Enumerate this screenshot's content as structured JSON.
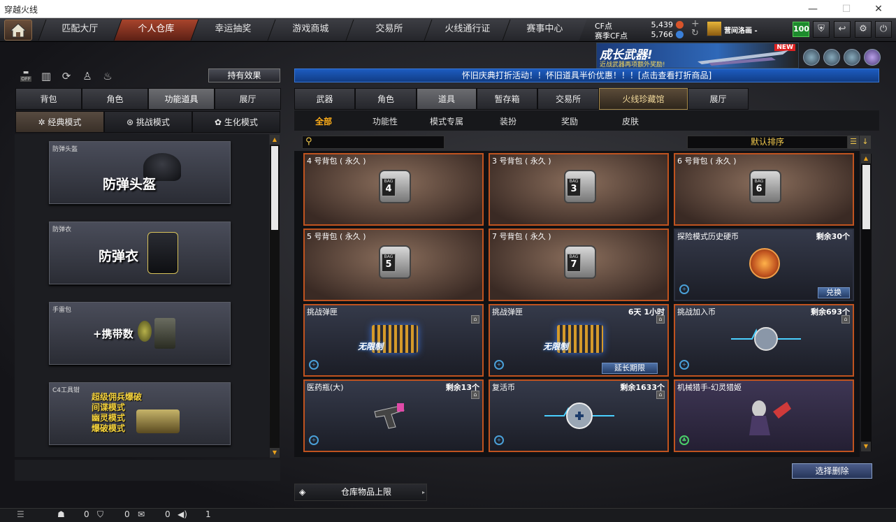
{
  "window": {
    "title": "穿越火线",
    "min": "—",
    "max": "☐",
    "close": "✕"
  },
  "nav": {
    "tabs": [
      "匹配大厅",
      "个人仓库",
      "幸运抽奖",
      "游戏商城",
      "交易所",
      "火线通行证",
      "赛事中心"
    ],
    "active_index": 1
  },
  "currency": {
    "cf_label": "CF点",
    "cf_value": "5,439",
    "season_label": "赛季CF点",
    "season_value": "5,766",
    "plus": "+",
    "refresh": "↻"
  },
  "user": {
    "name": "营间洛画 -",
    "level": "100"
  },
  "banner": {
    "title": "成长武器!",
    "subtitle": "近战武器再项额外奖励!",
    "badge": "NEW"
  },
  "left": {
    "toggle_label": "OFF",
    "holding_button": "持有效果",
    "tabs": [
      "背包",
      "角色",
      "功能道具",
      "展厅"
    ],
    "active_tab": 2,
    "modes": [
      {
        "label": "经典模式",
        "icon": "classic-mode-icon"
      },
      {
        "label": "挑战模式",
        "icon": "challenge-mode-icon"
      },
      {
        "label": "生化模式",
        "icon": "biochem-mode-icon"
      }
    ],
    "active_mode": 0,
    "cards": [
      {
        "caption": "防弹头盔",
        "big": "防弹头盔"
      },
      {
        "caption": "防弹衣",
        "big": "防弹衣"
      },
      {
        "caption": "手雷包",
        "big": "+携带数"
      },
      {
        "caption": "C4工具钳",
        "lines": [
          "超级佣兵爆破",
          "间谍模式",
          "幽灵模式",
          "爆破模式"
        ]
      }
    ]
  },
  "notice": "怀旧庆典打折活动！！怀旧道具半价优惠！！！[点击查看打折商品]",
  "right": {
    "tabs": [
      "武器",
      "角色",
      "道具",
      "暂存箱",
      "交易所",
      "火线珍藏馆",
      "展厅"
    ],
    "active_tab": 2,
    "special_tab": 5,
    "subtabs": [
      "全部",
      "功能性",
      "模式专属",
      "装扮",
      "奖励",
      "皮肤"
    ],
    "active_subtab": 0,
    "search_placeholder": "",
    "sort_label": "默认排序",
    "items": [
      {
        "name": "4 号背包 ( 永久 )",
        "type": "bag",
        "bag_no": "4"
      },
      {
        "name": "3 号背包 ( 永久 )",
        "type": "bag",
        "bag_no": "3"
      },
      {
        "name": "6 号背包 ( 永久 )",
        "type": "bag",
        "bag_no": "6"
      },
      {
        "name": "5 号背包 ( 永久 )",
        "type": "bag",
        "bag_no": "5"
      },
      {
        "name": "7 号背包 ( 永久 )",
        "type": "bag",
        "bag_no": "7"
      },
      {
        "name": "探险模式历史硬币",
        "type": "coin",
        "remain": "剩余30个",
        "action": "兑换"
      },
      {
        "name": "挑战弹匣",
        "type": "ammo",
        "caption": "无限制"
      },
      {
        "name": "挑战弹匣",
        "type": "ammo",
        "caption": "无限制",
        "remain": "6天 1小时",
        "action": "延长期限"
      },
      {
        "name": "挑战加入币",
        "type": "pulse",
        "remain": "剩余693个"
      },
      {
        "name": "医药瓶(大)",
        "type": "gun",
        "remain": "剩余13个"
      },
      {
        "name": "复活币",
        "type": "revive",
        "remain": "剩余1633个"
      },
      {
        "name": "机械猎手-幻灵猎姬",
        "type": "char"
      }
    ],
    "delete_button": "选择删除",
    "capacity_button": "仓库物品上限"
  },
  "statusbar": {
    "friends": "0",
    "shield": "0",
    "chat": "0",
    "volume": "1"
  }
}
